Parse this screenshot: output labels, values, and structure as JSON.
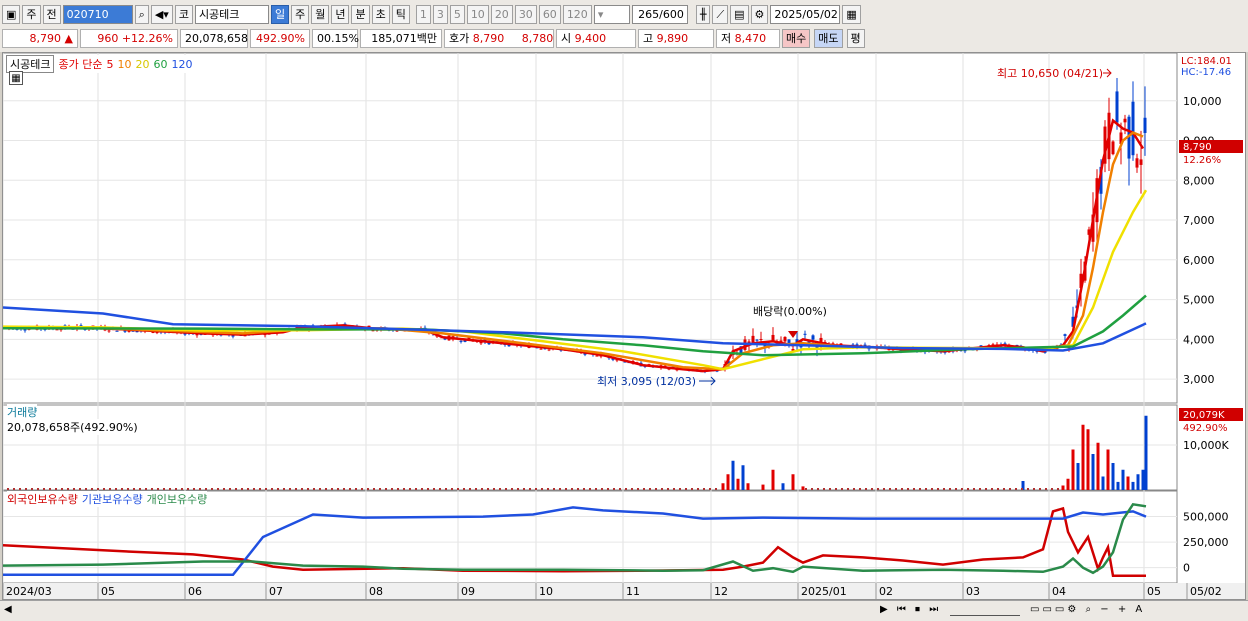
{
  "toolbar": {
    "market": "주",
    "prev": "전",
    "code": "020710",
    "name": "시공테크",
    "exchange": "코",
    "periods": [
      "일",
      "주",
      "월",
      "년",
      "분",
      "초",
      "틱"
    ],
    "nums": [
      "1",
      "3",
      "5",
      "10",
      "20",
      "30",
      "60",
      "120"
    ],
    "count": "265",
    "count_max": "/600",
    "date": "2025/05/02"
  },
  "quote": {
    "price": "8,790",
    "arrow": "▲",
    "change": "960",
    "pct": "+12.26%",
    "volume": "20,078,658",
    "vol_ratio": "492.90%",
    "turnover": "00.15%",
    "amount": "185,071백만",
    "hoga_label": "호가",
    "ask": "8,790",
    "bid": "8,780",
    "open_label": "시",
    "open": "9,400",
    "high_label": "고",
    "high": "9,890",
    "low_label": "저",
    "low": "8,470",
    "buy": "매수",
    "sell": "매도",
    "eval": "평"
  },
  "legend": {
    "name": "시공테크",
    "ma_label": "종가 단순",
    "ma5": "5",
    "ma10": "10",
    "ma20": "20",
    "ma60": "60",
    "ma120": "120",
    "volume": "거래량",
    "volume_value": "20,078,658주(492.90%)",
    "foreign": "외국인보유수량",
    "inst": "기관보유수량",
    "indiv": "개인보유수량"
  },
  "annot": {
    "lc": "LC:184.01",
    "hc": "HC:-17.46",
    "high": "최고 10,650 (04/21)",
    "low": "최저 3,095 (12/03)",
    "div": "배당락(0.00%)",
    "last_price": "8,790",
    "last_pct": "12.26%",
    "last_vol": "20,079K",
    "last_vol_pct": "492.90%"
  },
  "colors": {
    "up": "#e00000",
    "down": "#0040d0",
    "ma5": "#e00000",
    "ma10": "#f08000",
    "ma20": "#f0e000",
    "ma60": "#20a040",
    "ma120": "#2050e0"
  },
  "chart_data": {
    "type": "line",
    "price_axis": {
      "ticks": [
        10000,
        9000,
        8000,
        7000,
        6000,
        5000,
        4000,
        3000
      ],
      "tick_labels": [
        "10,000",
        "9,000",
        "8,000",
        "7,000",
        "6,000",
        "5,000",
        "4,000",
        "3,000"
      ],
      "ylim": [
        2600,
        11000
      ]
    },
    "volume_axis": {
      "ticks": [
        10000
      ],
      "tick_labels": [
        "10,000K"
      ]
    },
    "holdings_axis": {
      "ticks": [
        500000,
        250000,
        0
      ],
      "tick_labels": [
        "500,000",
        "250,000",
        "0"
      ]
    },
    "x_labels": [
      "2024/03",
      "05",
      "06",
      "07",
      "08",
      "09",
      "10",
      "11",
      "12",
      "2025/01",
      "02",
      "03",
      "04",
      "05",
      "05/02"
    ],
    "series": [
      {
        "name": "5",
        "points": [
          [
            0,
            4300
          ],
          [
            40,
            4280
          ],
          [
            80,
            4300
          ],
          [
            120,
            4250
          ],
          [
            160,
            4200
          ],
          [
            200,
            4150
          ],
          [
            240,
            4120
          ],
          [
            280,
            4180
          ],
          [
            300,
            4300
          ],
          [
            340,
            4350
          ],
          [
            380,
            4250
          ],
          [
            420,
            4250
          ],
          [
            440,
            4050
          ],
          [
            480,
            3950
          ],
          [
            520,
            3850
          ],
          [
            560,
            3750
          ],
          [
            600,
            3600
          ],
          [
            640,
            3350
          ],
          [
            680,
            3250
          ],
          [
            700,
            3200
          ],
          [
            720,
            3250
          ],
          [
            730,
            3700
          ],
          [
            750,
            3900
          ],
          [
            770,
            3950
          ],
          [
            790,
            3850
          ],
          [
            800,
            4000
          ],
          [
            830,
            3850
          ],
          [
            870,
            3800
          ],
          [
            900,
            3750
          ],
          [
            940,
            3700
          ],
          [
            980,
            3800
          ],
          [
            1000,
            3850
          ],
          [
            1020,
            3800
          ],
          [
            1040,
            3700
          ],
          [
            1060,
            3850
          ],
          [
            1070,
            4200
          ],
          [
            1080,
            5500
          ],
          [
            1090,
            7000
          ],
          [
            1100,
            8500
          ],
          [
            1110,
            9500
          ],
          [
            1120,
            9300
          ],
          [
            1130,
            9200
          ],
          [
            1140,
            8800
          ]
        ]
      },
      {
        "name": "10",
        "points": [
          [
            0,
            4300
          ],
          [
            80,
            4300
          ],
          [
            160,
            4220
          ],
          [
            240,
            4150
          ],
          [
            300,
            4250
          ],
          [
            380,
            4280
          ],
          [
            440,
            4150
          ],
          [
            520,
            3900
          ],
          [
            600,
            3650
          ],
          [
            680,
            3300
          ],
          [
            720,
            3250
          ],
          [
            740,
            3650
          ],
          [
            770,
            3850
          ],
          [
            800,
            3900
          ],
          [
            840,
            3820
          ],
          [
            900,
            3780
          ],
          [
            980,
            3780
          ],
          [
            1040,
            3760
          ],
          [
            1065,
            3850
          ],
          [
            1080,
            4600
          ],
          [
            1090,
            5800
          ],
          [
            1100,
            7200
          ],
          [
            1110,
            8400
          ],
          [
            1120,
            9000
          ],
          [
            1130,
            9200
          ],
          [
            1140,
            9100
          ]
        ]
      },
      {
        "name": "20",
        "points": [
          [
            0,
            4320
          ],
          [
            100,
            4300
          ],
          [
            200,
            4220
          ],
          [
            300,
            4230
          ],
          [
            400,
            4270
          ],
          [
            460,
            4200
          ],
          [
            540,
            3950
          ],
          [
            620,
            3700
          ],
          [
            700,
            3350
          ],
          [
            720,
            3250
          ],
          [
            760,
            3500
          ],
          [
            800,
            3750
          ],
          [
            860,
            3800
          ],
          [
            960,
            3780
          ],
          [
            1040,
            3760
          ],
          [
            1070,
            3850
          ],
          [
            1090,
            4800
          ],
          [
            1110,
            6200
          ],
          [
            1130,
            7200
          ],
          [
            1143,
            7750
          ]
        ]
      },
      {
        "name": "60",
        "points": [
          [
            0,
            4280
          ],
          [
            200,
            4270
          ],
          [
            300,
            4250
          ],
          [
            420,
            4250
          ],
          [
            500,
            4150
          ],
          [
            560,
            4000
          ],
          [
            640,
            3850
          ],
          [
            700,
            3700
          ],
          [
            760,
            3600
          ],
          [
            860,
            3650
          ],
          [
            960,
            3750
          ],
          [
            1040,
            3800
          ],
          [
            1070,
            3820
          ],
          [
            1100,
            4200
          ],
          [
            1120,
            4600
          ],
          [
            1143,
            5100
          ]
        ]
      },
      {
        "name": "120",
        "points": [
          [
            0,
            4800
          ],
          [
            100,
            4650
          ],
          [
            170,
            4380
          ],
          [
            300,
            4330
          ],
          [
            500,
            4180
          ],
          [
            640,
            4050
          ],
          [
            720,
            3900
          ],
          [
            800,
            3850
          ],
          [
            900,
            3780
          ],
          [
            1000,
            3760
          ],
          [
            1060,
            3720
          ],
          [
            1100,
            3900
          ],
          [
            1143,
            4400
          ]
        ]
      }
    ],
    "volume_bars": {
      "x": [
        720,
        725,
        730,
        735,
        740,
        745,
        760,
        770,
        780,
        790,
        800,
        1020,
        1060,
        1065,
        1070,
        1075,
        1080,
        1085,
        1090,
        1095,
        1100,
        1105,
        1110,
        1115,
        1120,
        1125,
        1130,
        1135,
        1140,
        1143
      ],
      "values": [
        1500,
        3500,
        6500,
        2500,
        5500,
        1500,
        1200,
        4500,
        1500,
        3500,
        800,
        2000,
        1000,
        2500,
        9000,
        6000,
        14500,
        13500,
        8000,
        10500,
        3000,
        9000,
        6000,
        1800,
        4500,
        3000,
        1800,
        3500,
        4500,
        16500
      ],
      "up": [
        1,
        1,
        0,
        1,
        0,
        1,
        1,
        1,
        0,
        1,
        1,
        0,
        1,
        1,
        1,
        0,
        1,
        1,
        0,
        1,
        0,
        1,
        0,
        0,
        0,
        1,
        0,
        0,
        0,
        0
      ]
    },
    "holdings": [
      {
        "name": "외국인보유수량",
        "points": [
          [
            0,
            220000
          ],
          [
            60,
            190000
          ],
          [
            120,
            160000
          ],
          [
            190,
            130000
          ],
          [
            240,
            80000
          ],
          [
            270,
            10000
          ],
          [
            300,
            -20000
          ],
          [
            400,
            -5000
          ],
          [
            460,
            -30000
          ],
          [
            560,
            -35000
          ],
          [
            640,
            -30000
          ],
          [
            720,
            -20000
          ],
          [
            740,
            10000
          ],
          [
            760,
            50000
          ],
          [
            775,
            200000
          ],
          [
            790,
            100000
          ],
          [
            800,
            50000
          ],
          [
            820,
            120000
          ],
          [
            860,
            100000
          ],
          [
            900,
            70000
          ],
          [
            940,
            30000
          ],
          [
            980,
            80000
          ],
          [
            1000,
            90000
          ],
          [
            1020,
            100000
          ],
          [
            1040,
            180000
          ],
          [
            1050,
            550000
          ],
          [
            1060,
            580000
          ],
          [
            1065,
            350000
          ],
          [
            1075,
            150000
          ],
          [
            1085,
            300000
          ],
          [
            1095,
            -10000
          ],
          [
            1100,
            100000
          ],
          [
            1105,
            200000
          ],
          [
            1110,
            -80000
          ],
          [
            1143,
            -80000
          ]
        ]
      },
      {
        "name": "기관보유수량",
        "points": [
          [
            0,
            -70000
          ],
          [
            230,
            -70000
          ],
          [
            260,
            300000
          ],
          [
            310,
            520000
          ],
          [
            360,
            490000
          ],
          [
            480,
            500000
          ],
          [
            530,
            520000
          ],
          [
            570,
            590000
          ],
          [
            600,
            560000
          ],
          [
            660,
            530000
          ],
          [
            700,
            480000
          ],
          [
            760,
            490000
          ],
          [
            860,
            480000
          ],
          [
            980,
            480000
          ],
          [
            1060,
            480000
          ],
          [
            1080,
            540000
          ],
          [
            1100,
            520000
          ],
          [
            1130,
            550000
          ],
          [
            1143,
            500000
          ]
        ]
      },
      {
        "name": "개인보유수량",
        "points": [
          [
            0,
            20000
          ],
          [
            100,
            30000
          ],
          [
            200,
            60000
          ],
          [
            250,
            60000
          ],
          [
            300,
            20000
          ],
          [
            360,
            10000
          ],
          [
            400,
            -10000
          ],
          [
            460,
            -20000
          ],
          [
            560,
            -20000
          ],
          [
            660,
            -30000
          ],
          [
            700,
            -25000
          ],
          [
            730,
            60000
          ],
          [
            750,
            -30000
          ],
          [
            770,
            -5000
          ],
          [
            790,
            -40000
          ],
          [
            800,
            10000
          ],
          [
            860,
            -30000
          ],
          [
            940,
            -20000
          ],
          [
            1000,
            -30000
          ],
          [
            1040,
            -40000
          ],
          [
            1060,
            10000
          ],
          [
            1070,
            90000
          ],
          [
            1080,
            0
          ],
          [
            1090,
            -50000
          ],
          [
            1100,
            10000
          ],
          [
            1110,
            150000
          ],
          [
            1120,
            470000
          ],
          [
            1130,
            620000
          ],
          [
            1143,
            600000
          ]
        ]
      }
    ]
  }
}
